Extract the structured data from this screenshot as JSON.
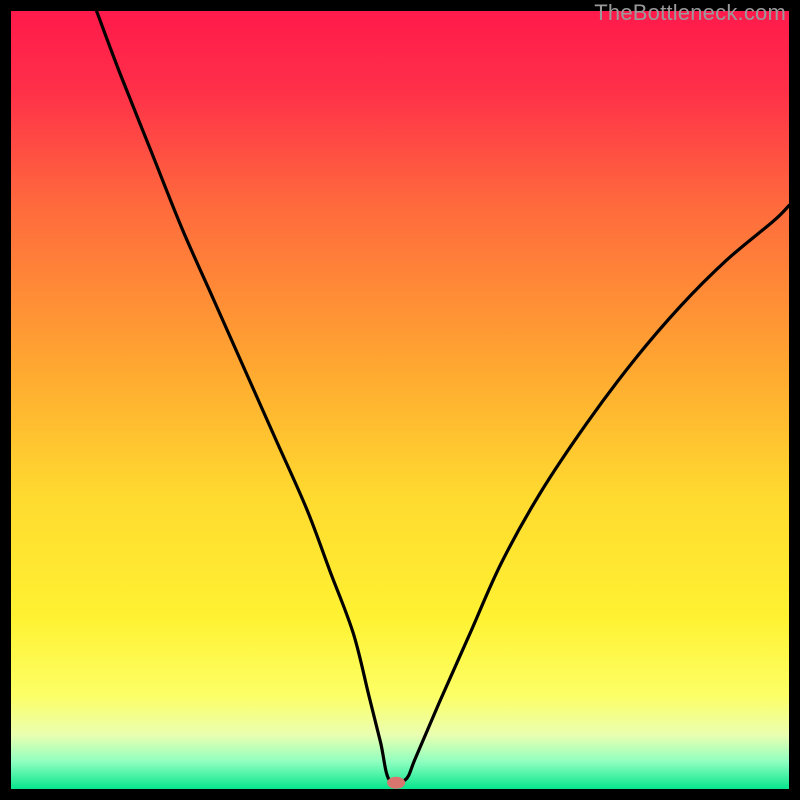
{
  "watermark": "TheBottleneck.com",
  "chart_data": {
    "type": "line",
    "title": "",
    "xlabel": "",
    "ylabel": "",
    "xlim": [
      0,
      100
    ],
    "ylim": [
      0,
      100
    ],
    "grid": false,
    "legend": false,
    "background_gradient": {
      "stops": [
        {
          "pos": 0.0,
          "color": "#ff1a4b"
        },
        {
          "pos": 0.1,
          "color": "#ff2f49"
        },
        {
          "pos": 0.25,
          "color": "#ff6a3d"
        },
        {
          "pos": 0.45,
          "color": "#ffa531"
        },
        {
          "pos": 0.62,
          "color": "#ffd92f"
        },
        {
          "pos": 0.78,
          "color": "#fff232"
        },
        {
          "pos": 0.88,
          "color": "#fcff66"
        },
        {
          "pos": 0.93,
          "color": "#eaffb0"
        },
        {
          "pos": 0.965,
          "color": "#8fffc0"
        },
        {
          "pos": 1.0,
          "color": "#06e58c"
        }
      ]
    },
    "marker": {
      "x": 49.5,
      "y": 0.8,
      "color": "#d9746e"
    },
    "series": [
      {
        "name": "curve",
        "color": "#000000",
        "x": [
          11,
          14,
          18,
          22,
          26,
          30,
          34,
          38,
          41,
          44,
          46,
          47.5,
          48.6,
          50.7,
          52,
          55,
          59,
          63,
          68,
          74,
          80,
          86,
          92,
          98,
          100
        ],
        "y": [
          100,
          92,
          82,
          72,
          63,
          54,
          45,
          36,
          28,
          20,
          12,
          6,
          1.2,
          1.2,
          4,
          11,
          20,
          29,
          38,
          47,
          55,
          62,
          68,
          73,
          75
        ]
      }
    ]
  }
}
